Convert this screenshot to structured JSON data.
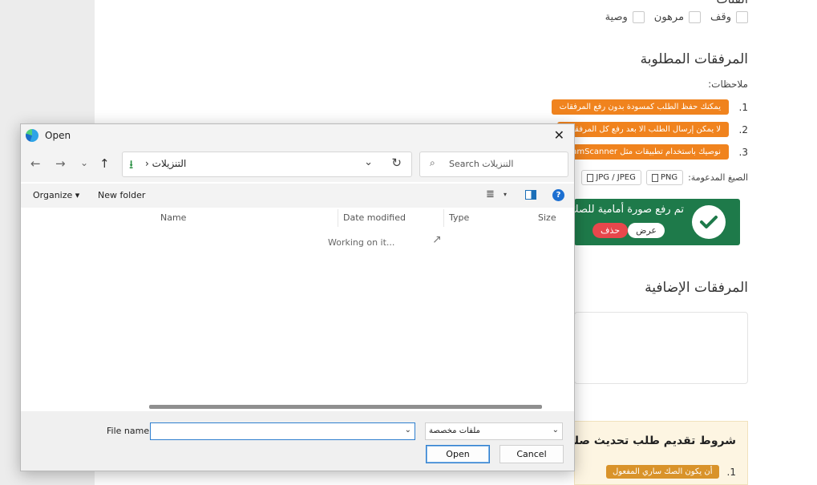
{
  "background_page": {
    "cut_title": "الفئات",
    "property_options": [
      "وقف",
      "مرهون",
      "وصية"
    ],
    "required_attachments_heading": "المرفقات المطلوبة",
    "notes_label": "ملاحظات:",
    "notes": [
      {
        "num": "1.",
        "text": "يمكنك حفظ الطلب كمسودة بدون رفع المرفقات"
      },
      {
        "num": "2.",
        "text": "لا يمكن إرسال الطلب الا بعد رفع كل المرفقات"
      },
      {
        "num": "3.",
        "text": "نوصيك باستخدام تطبيقات مثل CamScanner"
      }
    ],
    "formats_label": "الصيغ المدعومة:",
    "formats": [
      "PNG",
      "JPG / JPEG"
    ],
    "upload_status": {
      "message": "تم رفع صورة أمامية للصك",
      "view_label": "عرض",
      "delete_label": "حذف",
      "color": "#1e7a4a"
    },
    "additional_attachments_heading": "المرفقات الإضافية",
    "terms": {
      "title": "شروط تقديم طلب تحديث صك عقاري",
      "items": [
        {
          "num": "1.",
          "text": "أن يكون الصك ساري المفعول"
        }
      ]
    }
  },
  "dialog": {
    "title": "Open",
    "close_glyph": "✕",
    "nav": {
      "back_glyph": "←",
      "forward_glyph": "→",
      "recent_glyph": "⌄",
      "up_glyph": "↑"
    },
    "address": {
      "icon": "download-icon",
      "icon_glyph": "⭳",
      "separator": "›",
      "path": "التنزيلات",
      "dropdown_glyph": "⌄",
      "refresh_glyph": "↻"
    },
    "search": {
      "placeholder": "Search التنزيلات",
      "icon_glyph": "⌕"
    },
    "toolbar": {
      "organize": "Organize ▾",
      "new_folder": "New folder",
      "view_glyph": "≣",
      "view_dropdown_glyph": "▾",
      "help_glyph": "?"
    },
    "columns": [
      "Name",
      "Date modified",
      "Type",
      "Size"
    ],
    "status": "Working on it...",
    "file_name_label": "File name:",
    "file_name_value": "",
    "file_type": "ملفات مخصصة",
    "open_label": "Open",
    "cancel_label": "Cancel"
  },
  "colors": {
    "note_pill": "#f0831e",
    "delete_button": "#e8474c",
    "terms_background": "#fdf5e2",
    "accent_blue": "#2f7fcf"
  }
}
